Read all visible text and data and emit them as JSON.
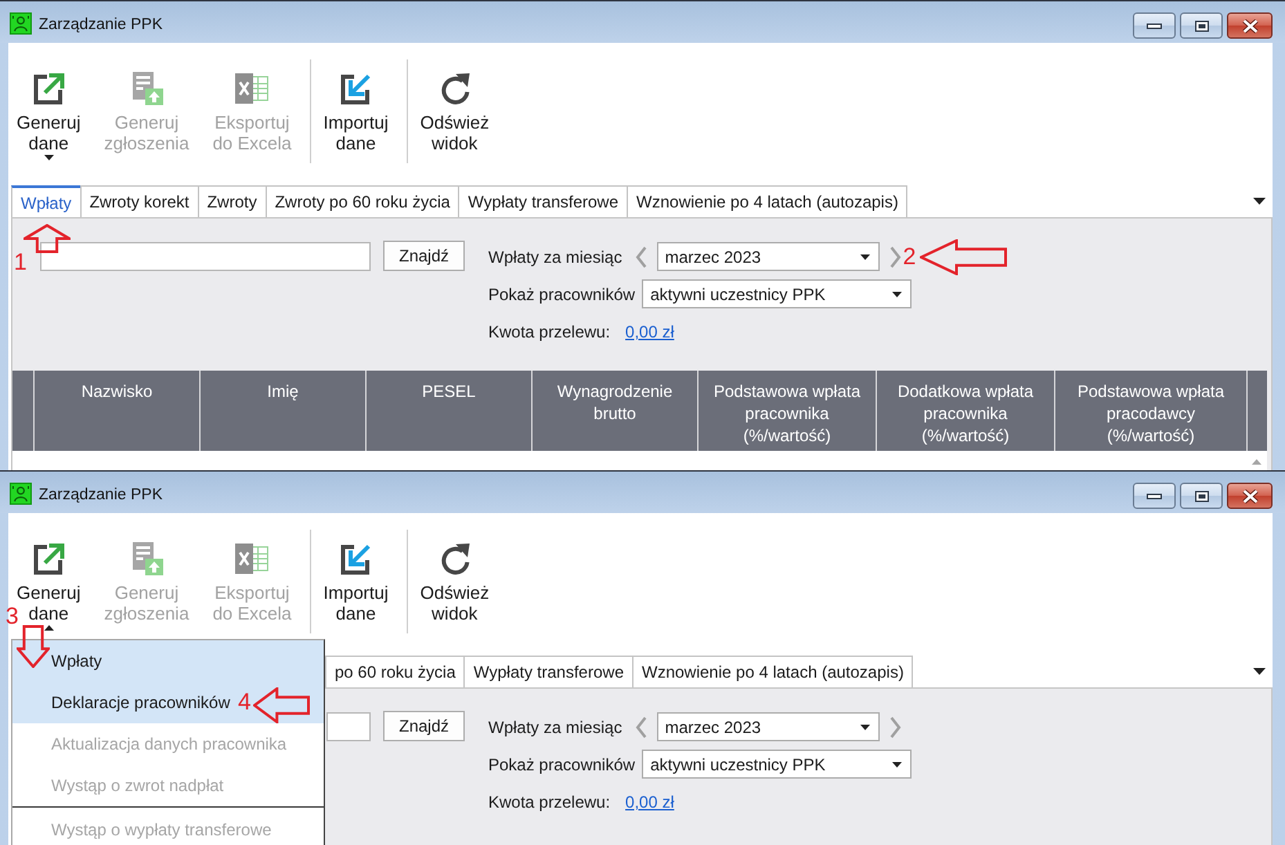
{
  "screenshots": [
    {
      "window": {
        "title": "Zarządzanie PPK"
      },
      "toolbar": [
        {
          "kind": "generate",
          "label": "Generuj\ndane",
          "disabled": false,
          "expanded": false
        },
        {
          "kind": "generate-forms",
          "label": "Generuj\nzgłoszenia",
          "disabled": true
        },
        {
          "kind": "excel",
          "label": "Eksportuj\ndo Excela",
          "disabled": true
        },
        {
          "kind": "separator"
        },
        {
          "kind": "import",
          "label": "Importuj\ndane",
          "disabled": false
        },
        {
          "kind": "separator"
        },
        {
          "kind": "refresh",
          "label": "Odśwież\nwidok",
          "disabled": false
        }
      ],
      "tabs": [
        {
          "label": "Wpłaty",
          "selected": true,
          "annotation": {
            "number": "1",
            "kind": "up"
          }
        },
        {
          "label": "Zwroty korekt",
          "selected": false
        },
        {
          "label": "Zwroty",
          "selected": false
        },
        {
          "label": "Zwroty po 60 roku życia",
          "selected": false
        },
        {
          "label": "Wypłaty transferowe",
          "selected": false
        },
        {
          "label": "Wznowienie po 4 latach (autozapis)",
          "selected": false
        }
      ],
      "filters": {
        "find_button": "Znajdź",
        "month_label": "Wpłaty za miesiąc",
        "month": "marzec 2023",
        "month_annotation": {
          "number": "2",
          "kind": "left"
        },
        "employees_label": "Pokaż pracowników",
        "employees": "aktywni uczestnicy PPK",
        "transfer_label": "Kwota przelewu:",
        "transfer_amount": "0,00 zł"
      },
      "table": {
        "columns": [
          "Nazwisko",
          "Imię",
          "PESEL",
          "Wynagrodzenie brutto",
          "Podstawowa wpłata pracownika (%/wartość)",
          "Dodatkowa wpłata pracownika (%/wartość)",
          "Podstawowa wpłata pracodawcy (%/wartość)"
        ]
      }
    },
    {
      "window": {
        "title": "Zarządzanie PPK"
      },
      "toolbar": [
        {
          "kind": "generate",
          "label": "Generuj\ndane",
          "disabled": false,
          "expanded": true,
          "annotation": {
            "number": "3",
            "kind": "down"
          }
        },
        {
          "kind": "generate-forms",
          "label": "Generuj\nzgłoszenia",
          "disabled": true
        },
        {
          "kind": "excel",
          "label": "Eksportuj\ndo Excela",
          "disabled": true
        },
        {
          "kind": "separator"
        },
        {
          "kind": "import",
          "label": "Importuj\ndane",
          "disabled": false
        },
        {
          "kind": "separator"
        },
        {
          "kind": "refresh",
          "label": "Odśwież\nwidok",
          "disabled": false
        }
      ],
      "menu": [
        {
          "kind": "item",
          "label": "Wpłaty",
          "highlighted": true,
          "disabled": false
        },
        {
          "kind": "item",
          "label": "Deklaracje pracowników",
          "highlighted": true,
          "disabled": false,
          "annotation": {
            "number": "4",
            "kind": "left"
          }
        },
        {
          "kind": "item",
          "label": "Aktualizacja danych pracownika",
          "highlighted": false,
          "disabled": true
        },
        {
          "kind": "item",
          "label": "Wystąp o zwrot nadpłat",
          "highlighted": false,
          "disabled": true
        },
        {
          "kind": "separator"
        },
        {
          "kind": "item",
          "label": "Wystąp o wypłaty transferowe",
          "highlighted": false,
          "disabled": true
        }
      ],
      "tabs": [
        {
          "label": "po 60 roku życia",
          "selected": false
        },
        {
          "label": "Wypłaty transferowe",
          "selected": false
        },
        {
          "label": "Wznowienie po 4 latach (autozapis)",
          "selected": false
        }
      ],
      "filters": {
        "find_button": "Znajdź",
        "month_label": "Wpłaty za miesiąc",
        "month": "marzec 2023",
        "employees_label": "Pokaż pracowników",
        "employees": "aktywni uczestnicy PPK",
        "transfer_label": "Kwota przelewu:",
        "transfer_amount": "0,00 zł"
      }
    }
  ]
}
